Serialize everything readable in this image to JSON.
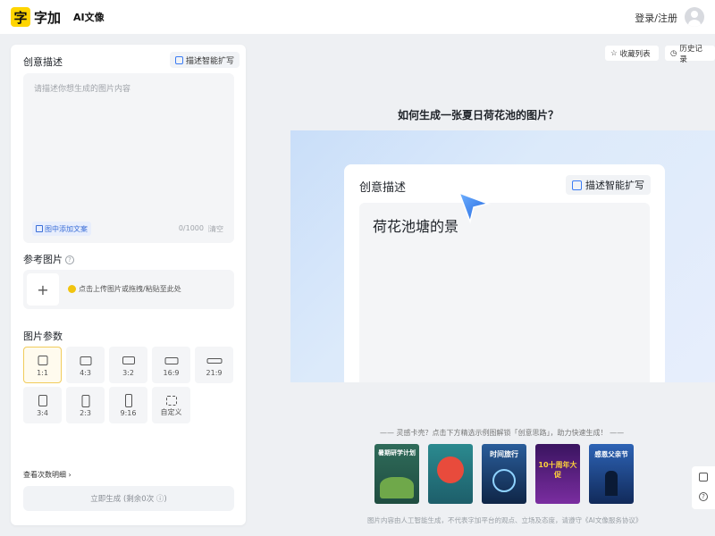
{
  "header": {
    "logo_mark": "字",
    "logo_text": "字加",
    "nav_item": "AI文像",
    "login_label": "登录/注册"
  },
  "panel": {
    "creative": {
      "title": "创意描述",
      "expand_label": "描述智能扩写",
      "placeholder": "请描述你想生成的图片内容",
      "add_text_label": "图中添加文案",
      "counter": "0/1000",
      "separator": "|",
      "clear_label": "清空"
    },
    "reference": {
      "title": "参考图片",
      "help": "?",
      "upload_plus": "+",
      "upload_hint": "点击上传图片或拖拽/粘贴至此处"
    },
    "params": {
      "title": "图片参数",
      "ratios": [
        {
          "label": "1:1",
          "active": true
        },
        {
          "label": "4:3",
          "active": false
        },
        {
          "label": "3:2",
          "active": false
        },
        {
          "label": "16:9",
          "active": false
        },
        {
          "label": "21:9",
          "active": false
        },
        {
          "label": "3:4",
          "active": false
        },
        {
          "label": "2:3",
          "active": false
        },
        {
          "label": "9:16",
          "active": false
        },
        {
          "label": "自定义",
          "active": false
        }
      ]
    },
    "usage_link": "查看次数明细 ›",
    "generate_label": "立即生成 (剩余0次 ⓘ)"
  },
  "toolbar": {
    "favorites_label": "收藏列表",
    "history_label": "历史记录"
  },
  "main": {
    "title": "如何生成一张夏日荷花池的图片？",
    "demo": {
      "card_title": "创意描述",
      "expand_label": "描述智能扩写",
      "typed_text": "荷花池塘的景"
    },
    "inspiration_text": "—— 灵感卡壳？点击下方精选示例图解锁「创意思路」，助力快速生成！ ——",
    "examples": [
      {
        "caption": "暑期研学计划",
        "bg": "#2f6b5a"
      },
      {
        "caption": "",
        "bg": "#2b8a8f"
      },
      {
        "caption": "时间旅行",
        "bg": "#1d3d6b"
      },
      {
        "caption": "10十周年大促",
        "bg": "#5a1e8a"
      },
      {
        "caption": "感恩父亲节",
        "bg": "#1e3f7a"
      }
    ],
    "footer_note": "图片内容由人工智能生成，不代表字加平台的观点、立场及态度，请遵守《AI文像服务协议》"
  },
  "side_tools": {
    "help": "?"
  },
  "colors": {
    "accent_yellow": "#ffd500",
    "active_border": "#f1cc5b",
    "link_blue": "#3b6fd8",
    "cursor_blue": "#2e79ef"
  }
}
